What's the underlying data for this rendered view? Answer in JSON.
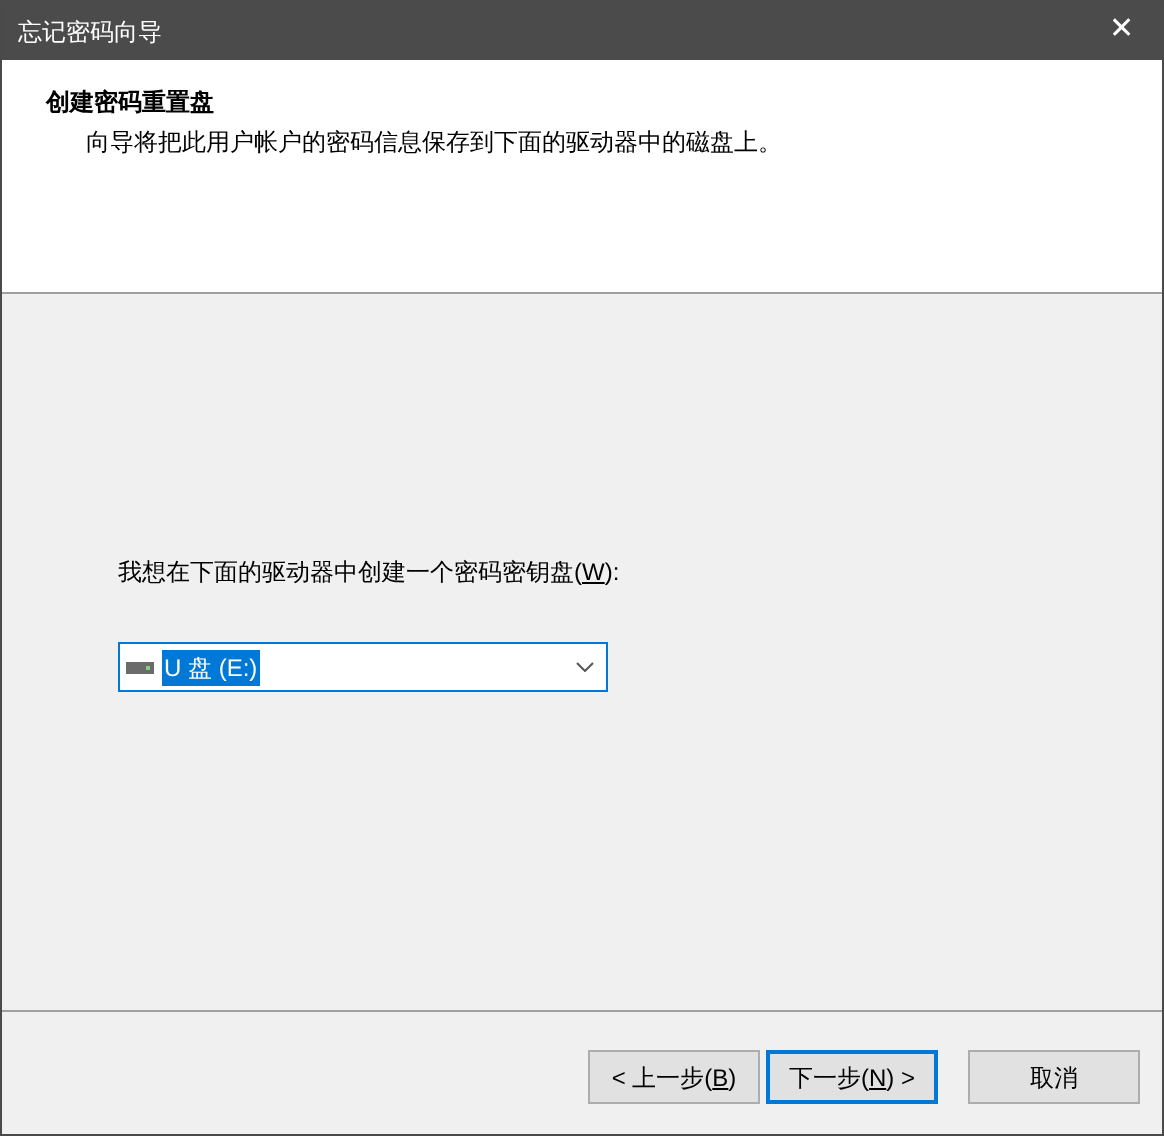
{
  "window": {
    "title": "忘记密码向导",
    "close": "✕"
  },
  "header": {
    "title": "创建密码重置盘",
    "subtitle": "向导将把此用户帐户的密码信息保存到下面的驱动器中的磁盘上。"
  },
  "drive_label": {
    "prefix": "我想在下面的驱动器中创建一个密码密钥盘(",
    "key": "W",
    "suffix": "):"
  },
  "drive_select": {
    "value": "U 盘 (E:)",
    "text_selected": true
  },
  "buttons": [
    {
      "prefix": "< 上一步(",
      "key": "B",
      "suffix": ")",
      "default": false
    },
    {
      "prefix": "下一步(",
      "key": "N",
      "suffix": ") >",
      "default": true
    },
    {
      "prefix": "取消",
      "default": false
    }
  ]
}
